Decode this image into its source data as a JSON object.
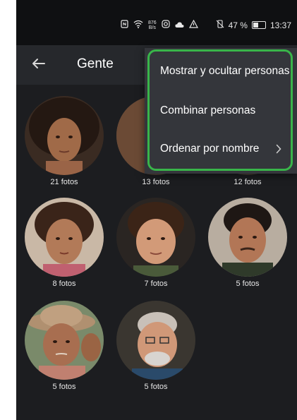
{
  "status_bar": {
    "net_speed_value": "876",
    "net_speed_unit": "B/s",
    "battery": "47 %",
    "time": "13:37"
  },
  "appbar": {
    "title": "Gente"
  },
  "menu": {
    "items": [
      {
        "label": "Mostrar y ocultar personas",
        "has_submenu": false
      },
      {
        "label": "Combinar personas",
        "has_submenu": false
      },
      {
        "label": "Ordenar por nombre",
        "has_submenu": true
      }
    ],
    "highlight_color": "#39b54a"
  },
  "people": [
    {
      "count": "21 fotos"
    },
    {
      "count": "13 fotos"
    },
    {
      "count": "12 fotos"
    },
    {
      "count": "8 fotos"
    },
    {
      "count": "7 fotos"
    },
    {
      "count": "5 fotos"
    },
    {
      "count": "5 fotos"
    },
    {
      "count": "5 fotos"
    }
  ],
  "colors": {
    "background": "#1c1d20",
    "appbar": "#26282c",
    "menu": "#34363b",
    "text": "#ffffff"
  }
}
